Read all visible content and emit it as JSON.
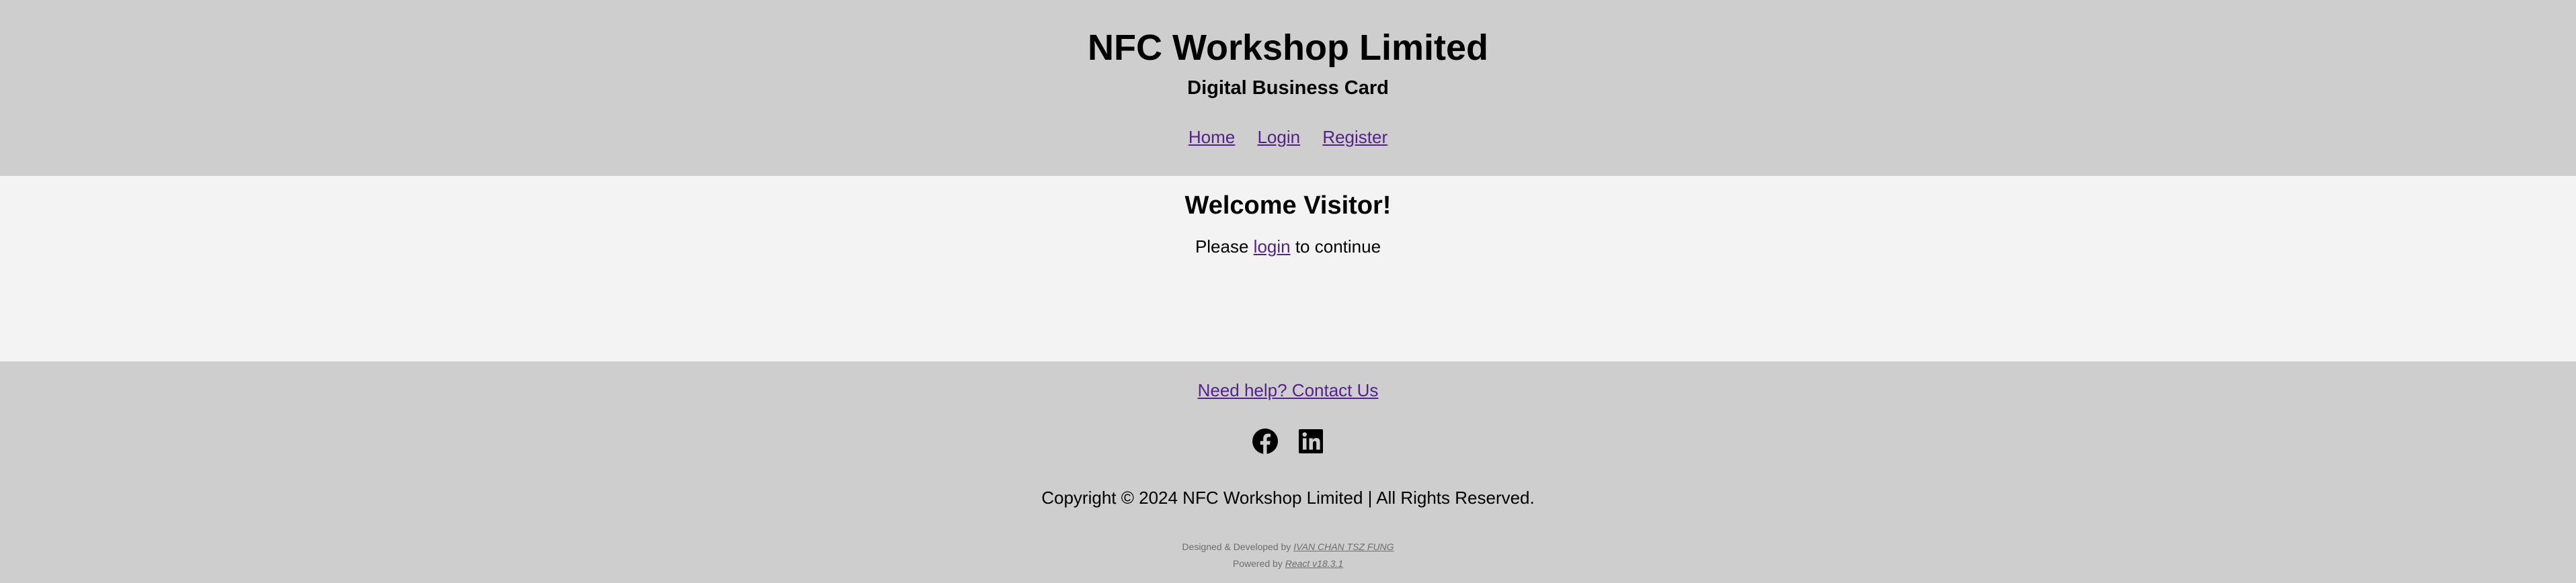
{
  "header": {
    "title": "NFC Workshop Limited",
    "subtitle": "Digital Business Card",
    "nav": [
      {
        "label": "Home"
      },
      {
        "label": "Login"
      },
      {
        "label": "Register"
      }
    ]
  },
  "main": {
    "welcome": "Welcome Visitor!",
    "prompt_before": "Please ",
    "prompt_link": "login",
    "prompt_after": " to continue"
  },
  "footer": {
    "help_link": "Need help? Contact Us",
    "social": [
      {
        "icon": "facebook-icon"
      },
      {
        "icon": "linkedin-icon"
      }
    ],
    "copyright": "Copyright © 2024 NFC Workshop Limited | All Rights Reserved.",
    "designed_prefix": "Designed & Developed by ",
    "designer": "IVAN CHAN TSZ FUNG",
    "powered_prefix": "Powered by ",
    "powered_tech": "React v18.3.1"
  },
  "colors": {
    "header_bg": "#cecece",
    "main_bg": "#f3f3f3",
    "link": "#55218b",
    "credits_text": "#6d6d6d"
  }
}
